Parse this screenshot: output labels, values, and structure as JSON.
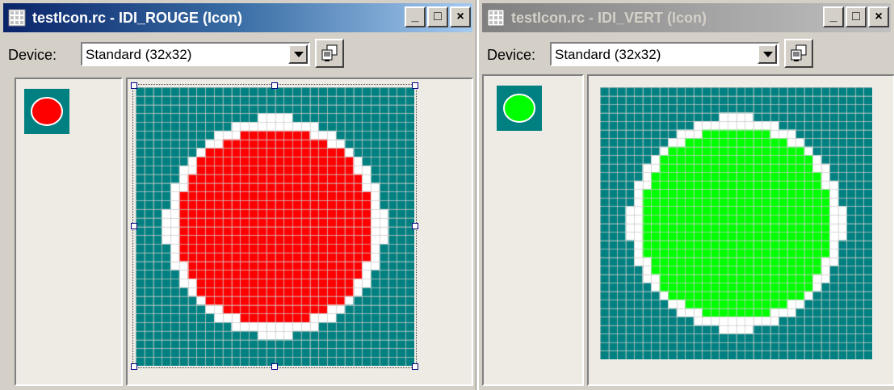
{
  "windows": [
    {
      "title": "testIcon.rc - IDI_ROUGE (Icon)",
      "active": true,
      "device_label": "Device:",
      "device_value": "Standard (32x32)",
      "icon_color": "#ff0000",
      "background_color": "#008080",
      "outline_color": "#ffffff",
      "caption_buttons": [
        "_",
        "□",
        "×"
      ]
    },
    {
      "title": "testIcon.rc - IDI_VERT (Icon)",
      "active": false,
      "device_label": "Device:",
      "device_value": "Standard (32x32)",
      "icon_color": "#00ff00",
      "background_color": "#008080",
      "outline_color": "#ffffff",
      "caption_buttons": [
        "_",
        "□",
        "×"
      ]
    }
  ],
  "pixel_grid": {
    "size": [
      32,
      32
    ]
  }
}
